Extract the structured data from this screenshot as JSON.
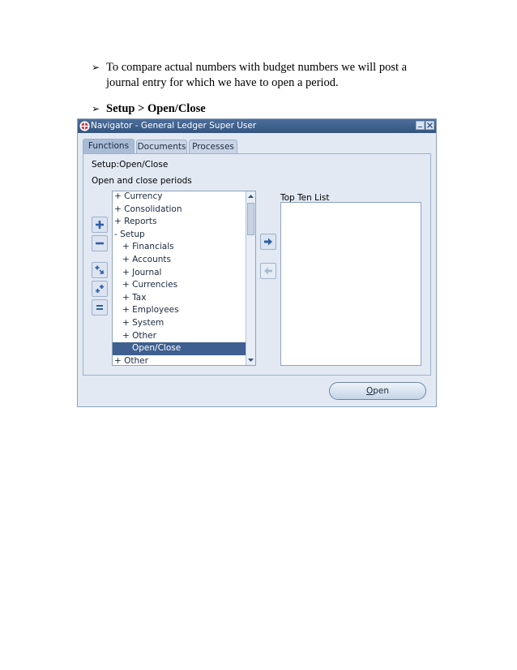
{
  "doc": {
    "bullet1_line1": "To compare actual numbers with budget numbers we will post a",
    "bullet1_line2": "journal entry for which we have to open a period.",
    "bullet2": "Setup > Open/Close",
    "bullet_glyph": "➢"
  },
  "window": {
    "title": "Navigator - General Ledger Super User",
    "tabs": [
      "Functions",
      "Documents",
      "Processes"
    ],
    "active_tab": "Functions",
    "path_label": "Setup:Open/Close",
    "description": "Open and close periods",
    "top_ten_label": "Top Ten List",
    "open_button": {
      "u": "O",
      "rest": "pen"
    },
    "tree": [
      {
        "label": "+ Currency"
      },
      {
        "label": "+ Consolidation"
      },
      {
        "label": "+ Reports"
      },
      {
        "label": "- Setup"
      },
      {
        "label": "+ Financials"
      },
      {
        "label": "+ Accounts"
      },
      {
        "label": "+ Journal"
      },
      {
        "label": "+ Currencies"
      },
      {
        "label": "+ Tax"
      },
      {
        "label": "+ Employees"
      },
      {
        "label": "+ System"
      },
      {
        "label": "+ Other"
      },
      {
        "label": "Open/Close",
        "selected": true
      },
      {
        "label": "+ Other"
      }
    ]
  },
  "colors": {
    "titlebar": "#3e5f8f",
    "selection": "#3e5f8f",
    "window_bg": "#e2e9f3",
    "icon_blue": "#2f5fa8"
  }
}
